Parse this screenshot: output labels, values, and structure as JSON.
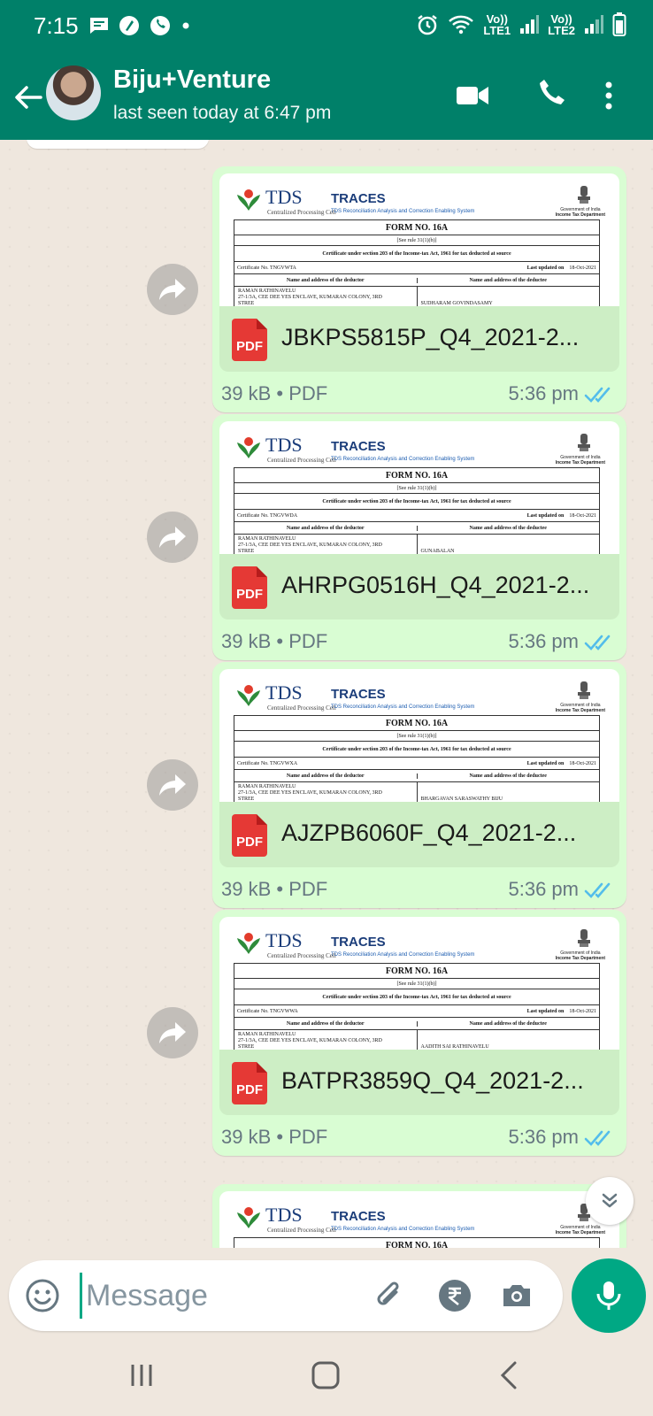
{
  "status_bar": {
    "time": "7:15",
    "sim1": "Vo))\nLTE1",
    "sim2": "Vo))\nLTE2",
    "sim1_top": "Vo))",
    "sim1_bottom": "LTE1",
    "sim2_top": "Vo))",
    "sim2_bottom": "LTE2"
  },
  "header": {
    "contact_name": "Biju+Venture",
    "last_seen": "last seen today at 6:47 pm",
    "icons": [
      "back-arrow-icon",
      "video-call-icon",
      "voice-call-icon",
      "more-options-icon"
    ]
  },
  "preview_doc": {
    "tds": "TDS",
    "cpc": "Centralized Processing Cell",
    "traces": "TRACES",
    "traces_sub": "TDS Reconciliation Analysis and Correction Enabling System",
    "gov1": "Government of India",
    "gov2": "Income Tax Department",
    "form_no": "FORM NO. 16A",
    "rule": "[See rule 31(1)(b)]",
    "cert_title": "Certificate under section 203 of the Income-tax Act, 1961 for tax deducted at source",
    "last_updated_label": "Last updated on",
    "last_updated": "18-Oct-2021",
    "deductor_col": "Name and address of the deductor",
    "deductee_col": "Name and address of the deductee",
    "deductor_name": "RAMAN RATHINAVELU",
    "deductor_addr": "27-1/3A, CEE DEE YES ENCLAVE, KUMARAN COLONY, 3RD",
    "deductor_addr2": "STREE"
  },
  "messages": [
    {
      "file_name": "JBKPS5815P_Q4_2021-2...",
      "cert_no": "Certificate No. TNGVWTA",
      "deductee": "SUDHARAM GOVINDASAMY",
      "size": "39 kB",
      "type": "PDF",
      "time": "5:36 pm",
      "pdf_badge": "PDF"
    },
    {
      "file_name": "AHRPG0516H_Q4_2021-2...",
      "cert_no": "Certificate No. TNGVWDA",
      "deductee": "GUNABALAN",
      "size": "39 kB",
      "type": "PDF",
      "time": "5:36 pm",
      "pdf_badge": "PDF"
    },
    {
      "file_name": "AJZPB6060F_Q4_2021-2...",
      "cert_no": "Certificate No. TNGVWXA",
      "deductee": "BHARGAVAN SARASWATHY BIJU",
      "size": "39 kB",
      "type": "PDF",
      "time": "5:36 pm",
      "pdf_badge": "PDF"
    },
    {
      "file_name": "BATPR3859Q_Q4_2021-2...",
      "cert_no": "Certificate No. TNGVWWA",
      "deductee": "AADITH SAI RATHINAVELU",
      "size": "39 kB",
      "type": "PDF",
      "time": "5:36 pm",
      "pdf_badge": "PDF"
    }
  ],
  "separator": "•",
  "composer": {
    "placeholder": "Message"
  },
  "colors": {
    "header": "#008069",
    "accent": "#00a884",
    "outgoing_bubble": "#d9fdd3",
    "read_ticks": "#53bdeb"
  }
}
